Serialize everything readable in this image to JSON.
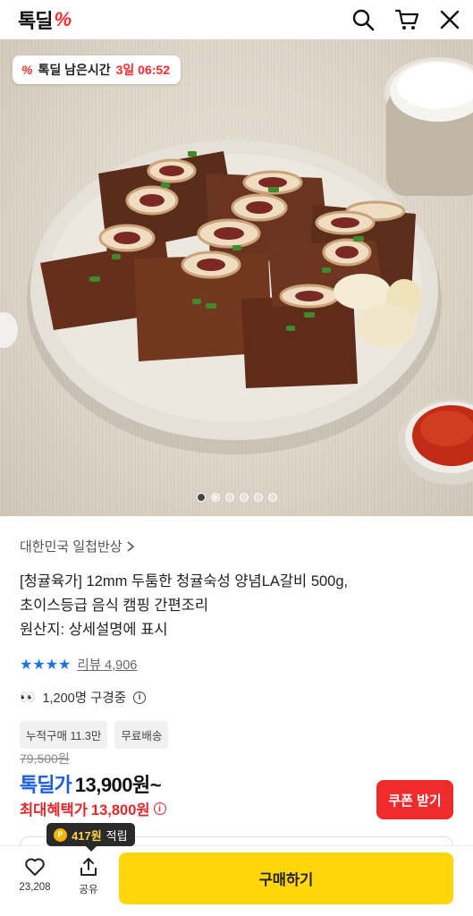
{
  "header": {
    "logo_text": "톡딜",
    "logo_mark": "%",
    "icons": [
      "search-icon",
      "cart-icon",
      "close-icon"
    ]
  },
  "hero": {
    "timer_prefix": "톡딜 남은시간",
    "timer_value": "3일 06:52",
    "image_count": 6,
    "active_index": 0
  },
  "product": {
    "seller": "대한민국 일첩반상",
    "title_line1": "[청귤육가] 12mm 두툼한 청귤숙성 양념LA갈비 500g,",
    "title_line2": "초이스등급 음식 캠핑 간편조리",
    "title_line3": "원산지: 상세설명에 표시",
    "rating_stars": 4,
    "review_label": "리뷰 4,906",
    "viewing_text": "1,200명 구경중",
    "tags": [
      "누적구매 11.3만",
      "무료배송"
    ]
  },
  "price": {
    "original": "79,500원",
    "deal_label": "톡딜가",
    "deal_price": "13,900원~",
    "max_label": "최대혜택가",
    "max_price": "13,800원",
    "coupon_button": "쿠폰 받기"
  },
  "points_tip": {
    "amount": "417원",
    "suffix": "적립"
  },
  "bottom": {
    "like_count": "23,208",
    "share_label": "공유",
    "buy_label": "구매하기"
  },
  "colors": {
    "deal_blue": "#1a5fe0",
    "accent_red": "#e8262a",
    "buy_yellow": "#ffd60a"
  }
}
